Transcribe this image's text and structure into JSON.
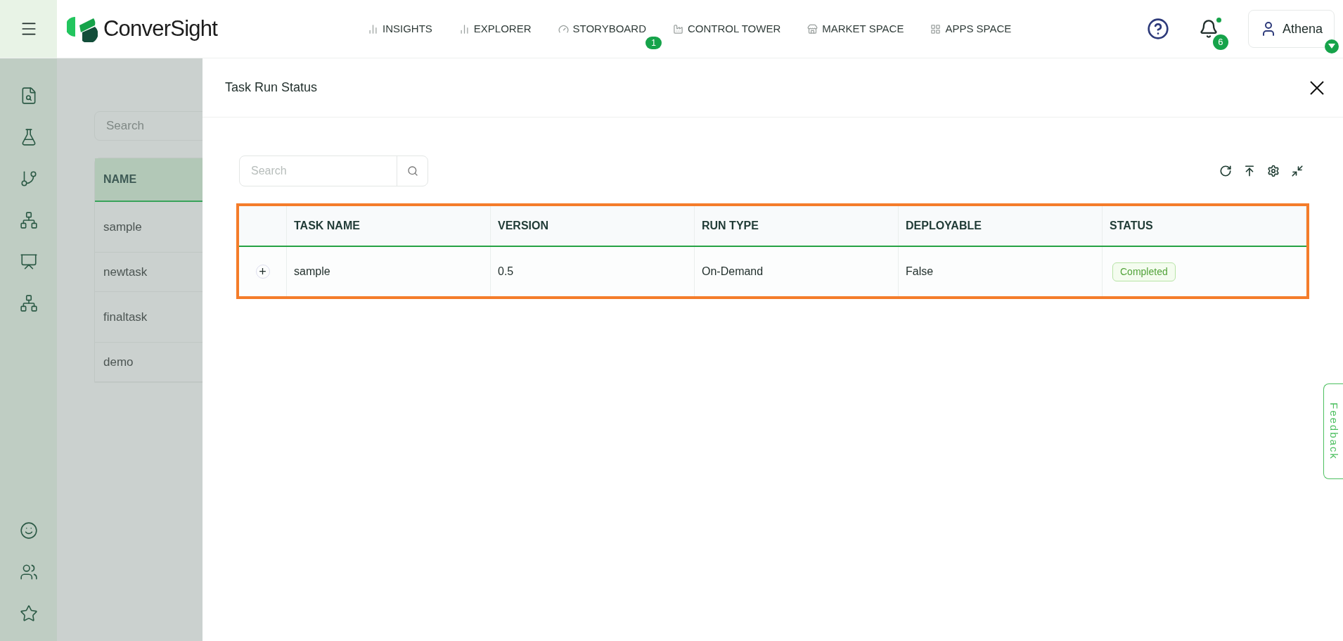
{
  "header": {
    "brand": "ConverSight",
    "nav": [
      {
        "label": "INSIGHTS"
      },
      {
        "label": "EXPLORER"
      },
      {
        "label": "STORYBOARD",
        "badge": "1"
      },
      {
        "label": "CONTROL TOWER"
      },
      {
        "label": "MARKET SPACE"
      },
      {
        "label": "APPS SPACE"
      }
    ],
    "notifications": "6",
    "user": "Athena"
  },
  "background_list": {
    "search": {
      "placeholder": "Search"
    },
    "column": "NAME",
    "rows": [
      "sample",
      "newtask",
      "finaltask",
      "demo"
    ]
  },
  "drawer": {
    "title": "Task Run Status",
    "search": {
      "placeholder": "Search"
    },
    "table": {
      "columns": [
        "TASK NAME",
        "VERSION",
        "RUN TYPE",
        "DEPLOYABLE",
        "STATUS"
      ],
      "rows": [
        {
          "expand": "+",
          "cells": [
            "sample",
            "0.5",
            "On-Demand",
            "False"
          ],
          "status": "Completed"
        }
      ]
    }
  },
  "feedback": "Feedback"
}
